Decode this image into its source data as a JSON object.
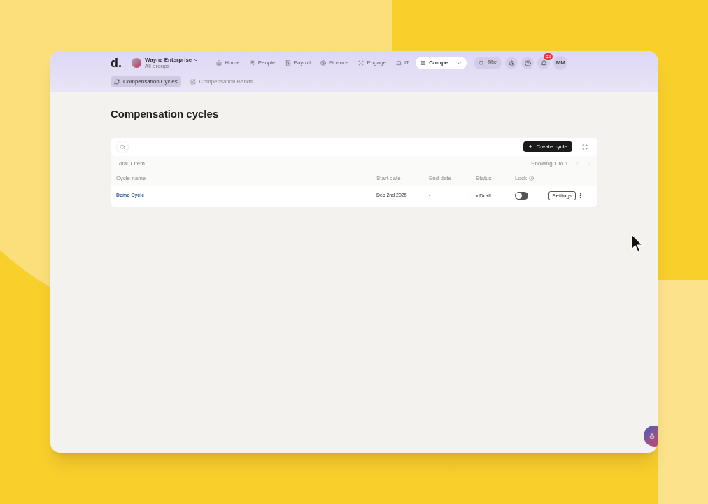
{
  "brand": {
    "logo": "d.",
    "org_name": "Wayne Enterprise",
    "org_sub": "All groups"
  },
  "nav": [
    {
      "label": "Home",
      "selected": false
    },
    {
      "label": "People",
      "selected": false
    },
    {
      "label": "Payroll",
      "selected": false
    },
    {
      "label": "Finance",
      "selected": false
    },
    {
      "label": "Engage",
      "selected": false
    },
    {
      "label": "IT",
      "selected": false
    },
    {
      "label": "Compe...",
      "selected": true
    }
  ],
  "search_shortcut": "⌘K",
  "notification_count": "61",
  "avatar_initials": "MM",
  "subtabs": [
    {
      "label": "Compensation Cycles",
      "selected": true
    },
    {
      "label": "Compensation Bands",
      "selected": false
    }
  ],
  "title": "Compensation cycles",
  "create_button": "Create cycle",
  "total": "Total 1 item",
  "showing": "Showing 1 to 1",
  "columns": [
    "Cycle name",
    "Start date",
    "End date",
    "Status",
    "Lock"
  ],
  "rows": [
    {
      "name": "Demo Cycle",
      "start": "Dec 2nd 2025",
      "end": "-",
      "status": "Draft",
      "locked": false,
      "action": "Settings"
    }
  ]
}
